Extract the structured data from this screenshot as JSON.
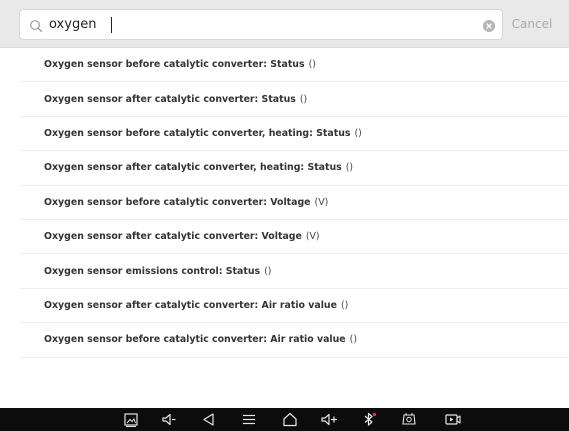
{
  "search": {
    "value": "oxygen",
    "cancel_label": "Cancel"
  },
  "icons": {
    "search": "search-icon",
    "clear": "clear-icon"
  },
  "results": [
    {
      "name": "Oxygen sensor before catalytic converter: Status",
      "unit": "()"
    },
    {
      "name": "Oxygen sensor after catalytic converter: Status",
      "unit": "()"
    },
    {
      "name": "Oxygen sensor before catalytic converter, heating: Status",
      "unit": "()"
    },
    {
      "name": "Oxygen sensor after catalytic converter, heating: Status",
      "unit": "()"
    },
    {
      "name": "Oxygen sensor before catalytic converter: Voltage",
      "unit": "(V)"
    },
    {
      "name": "Oxygen sensor after catalytic converter: Voltage",
      "unit": "(V)"
    },
    {
      "name": "Oxygen sensor emissions control: Status",
      "unit": "()"
    },
    {
      "name": "Oxygen sensor after catalytic converter: Air ratio value",
      "unit": "()"
    },
    {
      "name": "Oxygen sensor before catalytic converter: Air ratio value",
      "unit": "()"
    }
  ],
  "nav_bar": {
    "buttons": [
      "screenshot-icon",
      "volume-down-icon",
      "back-icon",
      "menu-icon",
      "home-icon",
      "volume-up-icon",
      "bluetooth-icon",
      "vci-icon",
      "screen-record-icon"
    ],
    "bluetooth_alert_color": "#e53935"
  }
}
